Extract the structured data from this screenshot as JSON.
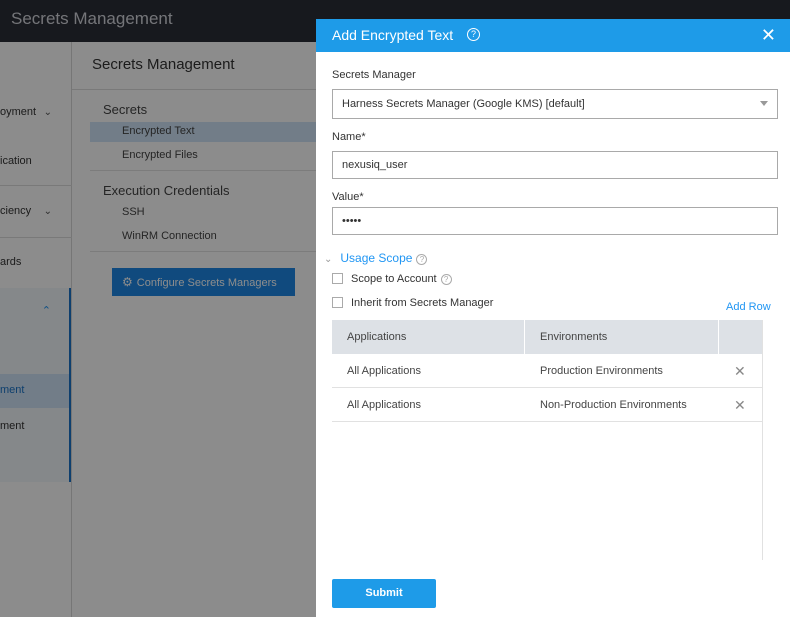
{
  "app": {
    "title": "Secrets Management"
  },
  "leftnav": {
    "items": [
      {
        "label": "oyment",
        "has_chevron": true
      },
      {
        "label": "ication",
        "has_chevron": false
      },
      {
        "label": "ciency",
        "has_chevron": true
      },
      {
        "label": "ards",
        "has_chevron": false
      }
    ],
    "section_items": [
      {
        "label": "ment",
        "active": true
      },
      {
        "label": "ment",
        "active": false
      }
    ]
  },
  "page": {
    "title": "Secrets Management"
  },
  "subnav": {
    "groups": [
      {
        "title": "Secrets",
        "items": [
          "Encrypted Text",
          "Encrypted Files"
        ]
      },
      {
        "title": "Execution Credentials",
        "items": [
          "SSH",
          "WinRM Connection"
        ]
      }
    ],
    "configure_button": "Configure Secrets Managers"
  },
  "modal": {
    "title": "Add Encrypted Text",
    "secrets_manager_label": "Secrets Manager",
    "secrets_manager_value": "Harness Secrets Manager (Google KMS) [default]",
    "name_label": "Name*",
    "name_value": "nexusiq_user",
    "value_label": "Value*",
    "value_masked": "•••••",
    "usage_scope_label": "Usage Scope",
    "scope_to_account_label": "Scope to Account",
    "inherit_label": "Inherit from Secrets Manager",
    "add_row_label": "Add Row",
    "table": {
      "headers": [
        "Applications",
        "Environments"
      ],
      "rows": [
        [
          "All Applications",
          "Production Environments"
        ],
        [
          "All Applications",
          "Non-Production Environments"
        ]
      ]
    },
    "submit_label": "Submit"
  },
  "colors": {
    "accent": "#1e9be8",
    "topbar": "#2b2e38"
  }
}
